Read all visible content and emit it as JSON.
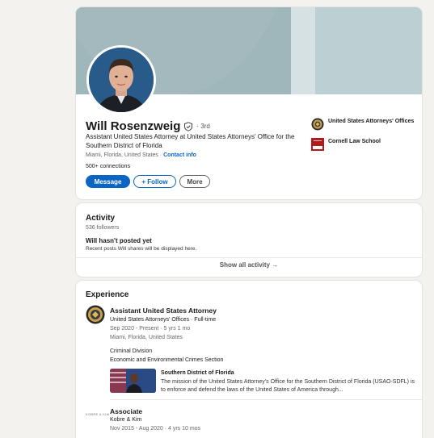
{
  "profile": {
    "name": "Will Rosenzweig",
    "degree": "· 3rd",
    "headline": "Assistant United States Attorney at United States Attorneys' Office for the Southern District of Florida",
    "location": "Miami, Florida, United States ·",
    "contact_info": "Contact info",
    "connections": "500+ connections",
    "buttons": {
      "message": "Message",
      "follow": "+ Follow",
      "more": "More"
    },
    "orgs": [
      {
        "name": "United States Attorneys' Offices",
        "icon": "doj-seal-icon"
      },
      {
        "name": "Cornell Law School",
        "icon": "cornell-logo-icon"
      }
    ]
  },
  "activity": {
    "title": "Activity",
    "followers": "536 followers",
    "empty_title": "Will hasn't posted yet",
    "empty_sub": "Recent posts Will shares will be displayed here.",
    "show_all": "Show all activity →"
  },
  "experience": {
    "title": "Experience",
    "items": [
      {
        "title": "Assistant United States Attorney",
        "company": "United States Attorneys' Offices · Full-time",
        "dates": "Sep 2020 - Present · 5 yrs 1 mo",
        "location": "Miami, Florida, United States",
        "division": "Criminal Division",
        "section": "Economic and Environmental Crimes Section",
        "media_title": "Southern District of Florida",
        "media_desc": "The mission of the United States Attorney's Office for the Southern District of Florida (USAO-SDFL) is to enforce and defend the laws of the United States of America through..."
      },
      {
        "title": "Associate",
        "company": "Kobre & Kim",
        "dates": "Nov 2015 - Aug 2020 · 4 yrs 10 mos",
        "logo_text": "KOBRE & KIM"
      }
    ]
  },
  "colors": {
    "accent": "#0a66c2",
    "banner": "#a7bcc0",
    "page_bg": "#f3f2ef"
  }
}
